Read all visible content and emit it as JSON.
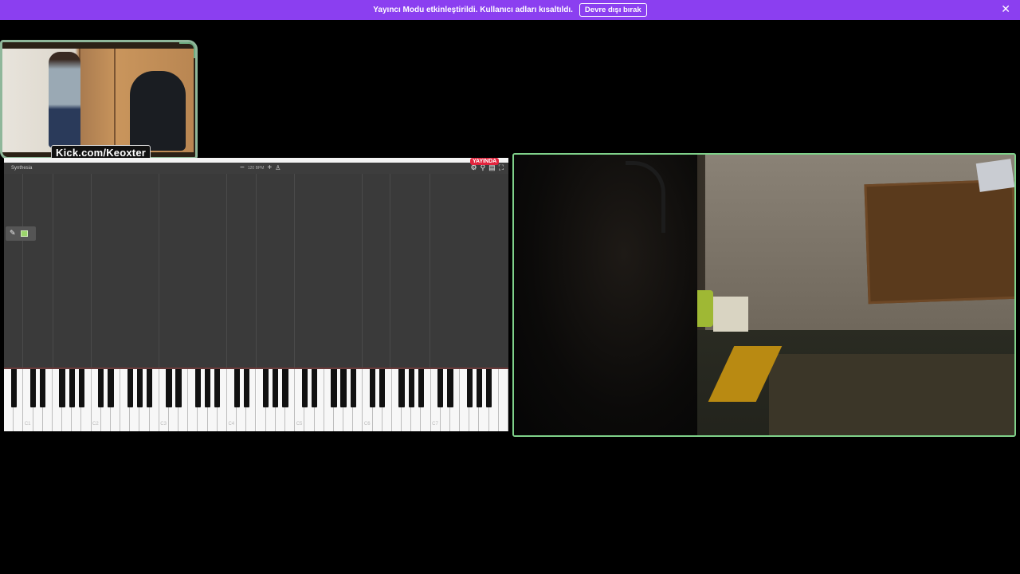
{
  "banner": {
    "message": "Yayıncı Modu etkinleştirildi. Kullanıcı adları kısaltıldı.",
    "disable_label": "Devre dışı bırak",
    "close_glyph": "✕",
    "background": "#8b3ff0"
  },
  "webcam_overlay": {
    "label": "Kick.com/Keoxter",
    "border_color": "#8fb79a"
  },
  "synthesia": {
    "title": "Synthesia",
    "tempo": "120 BPM",
    "minus_glyph": "−",
    "plus_glyph": "+",
    "metronome_icon": "metronome-icon",
    "live_badge": "YAYINDA",
    "toolbar_icons": [
      "settings-icon",
      "search-icon",
      "chart-icon",
      "fullscreen-icon"
    ],
    "instrument_icon": "piano-icon",
    "track_color": "#9ad46b",
    "key_labels": [
      "C1",
      "C2",
      "C3",
      "C4",
      "C5",
      "C6",
      "C7"
    ]
  },
  "main_camera": {
    "border_color": "#7fd18a"
  }
}
